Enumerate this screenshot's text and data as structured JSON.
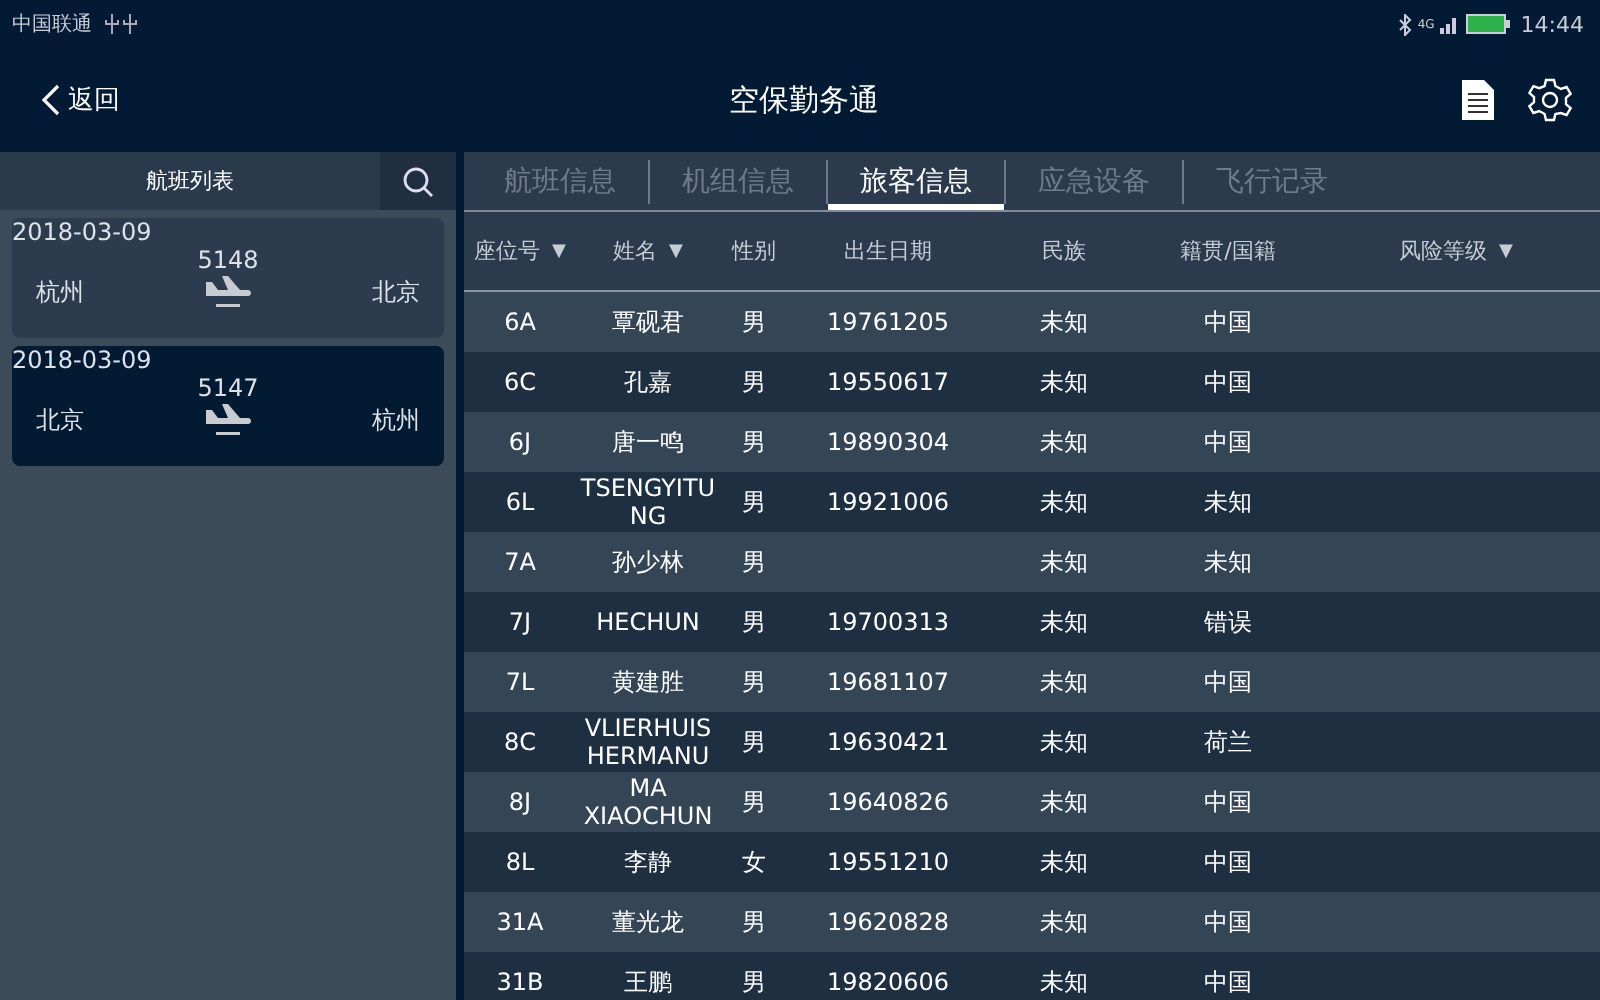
{
  "status_bar": {
    "carrier": "中国联通",
    "network": "4G",
    "time": "14:44"
  },
  "header": {
    "back": "返回",
    "title": "空保勤务通"
  },
  "sidebar": {
    "title": "航班列表",
    "flights": [
      {
        "date": "2018-03-09",
        "number": "5148",
        "from": "杭州",
        "to": "北京",
        "selected": false
      },
      {
        "date": "2018-03-09",
        "number": "5147",
        "from": "北京",
        "to": "杭州",
        "selected": true
      }
    ]
  },
  "tabs": [
    {
      "label": "航班信息",
      "selected": false
    },
    {
      "label": "机组信息",
      "selected": false
    },
    {
      "label": "旅客信息",
      "selected": true
    },
    {
      "label": "应急设备",
      "selected": false
    },
    {
      "label": "飞行记录",
      "selected": false
    }
  ],
  "table": {
    "columns": [
      {
        "label": "座位号",
        "arrow": "▼"
      },
      {
        "label": "姓名",
        "arrow": "▼"
      },
      {
        "label": "性别"
      },
      {
        "label": "出生日期"
      },
      {
        "label": "民族"
      },
      {
        "label": "籍贯/国籍"
      },
      {
        "label": "风险等级",
        "arrow": "▼"
      }
    ],
    "rows": [
      [
        "6A",
        "覃砚君",
        "男",
        "19761205",
        "未知",
        "中国"
      ],
      [
        "6C",
        "孔嘉",
        "男",
        "19550617",
        "未知",
        "中国"
      ],
      [
        "6J",
        "唐一鸣",
        "男",
        "19890304",
        "未知",
        "中国"
      ],
      [
        "6L",
        "TSENGYITUNG",
        "男",
        "19921006",
        "未知",
        "未知"
      ],
      [
        "7A",
        "孙少林",
        "男",
        "",
        "未知",
        "未知"
      ],
      [
        "7J",
        "HECHUN",
        "男",
        "19700313",
        "未知",
        "错误"
      ],
      [
        "7L",
        "黄建胜",
        "男",
        "19681107",
        "未知",
        "中国"
      ],
      [
        "8C",
        "VLIERHUIS HERMANU",
        "男",
        "19630421",
        "未知",
        "荷兰"
      ],
      [
        "8J",
        "MA XIAOCHUN",
        "男",
        "19640826",
        "未知",
        "中国"
      ],
      [
        "8L",
        "李静",
        "女",
        "19551210",
        "未知",
        "中国"
      ],
      [
        "31A",
        "董光龙",
        "男",
        "19620828",
        "未知",
        "中国"
      ],
      [
        "31B",
        "王鹏",
        "男",
        "19820606",
        "未知",
        "中国"
      ]
    ]
  }
}
